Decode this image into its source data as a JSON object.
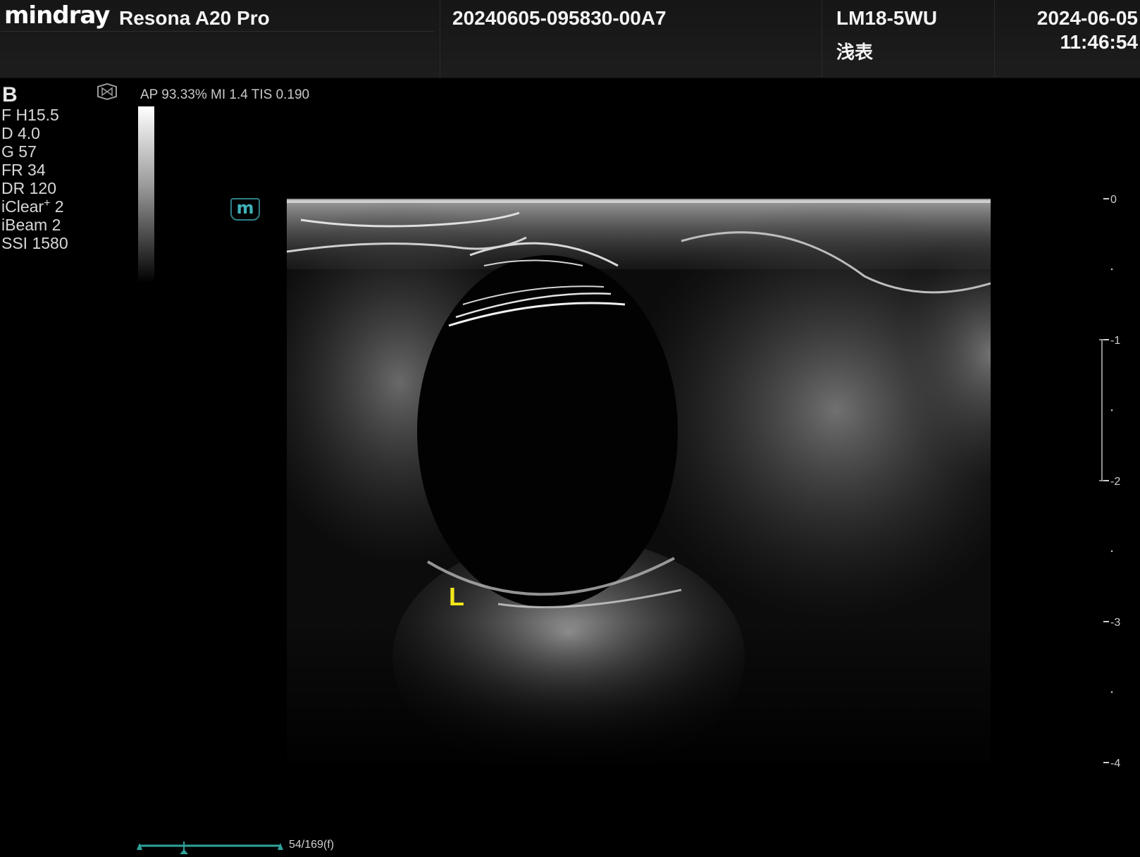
{
  "header": {
    "brand": "mindray",
    "model": "Resona A20 Pro",
    "exam_id": "20240605-095830-00A7",
    "probe": "LM18-5WU",
    "preset": "浅表",
    "date": "2024-06-05",
    "time": "11:46:54"
  },
  "imaging": {
    "mode": "B",
    "params": [
      "F H15.5",
      "D 4.0",
      "G 57",
      "FR 34",
      "DR 120"
    ],
    "iclear_label": "iClear",
    "iclear_sup": "+",
    "iclear_value": " 2",
    "params_after": [
      "iBeam 2",
      "SSI 1580"
    ],
    "output": "AP 93.33%   MI 1.4  TIS 0.190",
    "marker": "m",
    "orientation_label": "L"
  },
  "depth_scale": {
    "unit_values": [
      0,
      1,
      2,
      3,
      4
    ],
    "labels": [
      "0",
      "-1",
      "-2",
      "-3",
      "-4"
    ],
    "max_depth": 4.0
  },
  "cine": {
    "frame_label": "54/169(f)",
    "current_frame": 54,
    "total_frames": 169
  },
  "colors": {
    "header_bg": "#1a1a1a",
    "accent_teal": "#2fa39c",
    "orientation_yellow": "#f2e71a"
  }
}
